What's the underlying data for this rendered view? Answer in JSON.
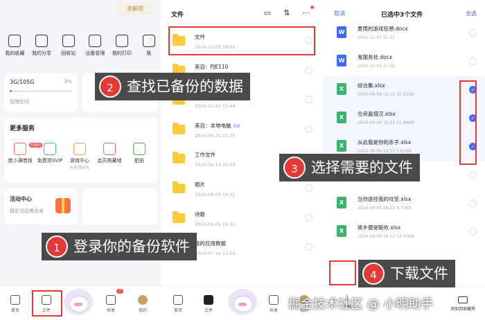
{
  "p1": {
    "top_pill": "去解锁",
    "quick": [
      {
        "icon": "star-icon",
        "label": "我的收藏"
      },
      {
        "icon": "share-icon",
        "label": "我的分享"
      },
      {
        "icon": "recycle-icon",
        "label": "回收站"
      },
      {
        "icon": "device-icon",
        "label": "设备管理"
      },
      {
        "icon": "printer-icon",
        "label": "我的打印"
      },
      {
        "icon": "more-icon",
        "label": "我"
      }
    ],
    "storage": {
      "text": "3G/105G",
      "percent": "3%",
      "progress": 0.03,
      "manage": "管理空间"
    },
    "services": {
      "title": "更多服务",
      "items": [
        {
          "label": "度小满借钱",
          "sub": "",
          "color": "#ff6b6b",
          "badge": "有福利"
        },
        {
          "label": "免费领SVIP",
          "sub": "",
          "color": "#3cc77b",
          "badge": ""
        },
        {
          "label": "游戏中心",
          "sub": "天天领好礼",
          "color": "#ff9f43",
          "badge": ""
        },
        {
          "label": "会员购藏域",
          "sub": "",
          "color": "#ff5c7a",
          "badge": ""
        },
        {
          "label": "航拍",
          "sub": "",
          "color": "#4caf50",
          "badge": ""
        }
      ]
    },
    "activity": {
      "title": "活动中心",
      "desc": "精彩活动等你来"
    },
    "tabs": [
      {
        "label": "首页"
      },
      {
        "label": "文件"
      },
      {
        "label": "共享"
      },
      {
        "label": "我的"
      }
    ],
    "share_badge": "7"
  },
  "p2": {
    "title": "文件",
    "files": [
      {
        "name": "文件",
        "date": "2024-12-03  18:00",
        "src": ""
      },
      {
        "name": "来自：PJE110",
        "date": "2024-11-15  15:44",
        "src": ""
      },
      {
        "name": "来自：微信备份",
        "date": "2024-11-15  15:44",
        "src": ""
      },
      {
        "name": "来自：本地电脑",
        "date": "2024-09-20  15:35",
        "src": "同步"
      },
      {
        "name": "工作文件",
        "date": "2024-09-14  15:03",
        "src": ""
      },
      {
        "name": "照片",
        "date": "2024-08-09  16:31",
        "src": ""
      },
      {
        "name": "诗歌",
        "date": "2024-08-09  16:31",
        "src": ""
      },
      {
        "name": "我的应用数据",
        "date": "2024-07-16  13:52",
        "src": ""
      }
    ],
    "tabs": [
      {
        "label": "首页"
      },
      {
        "label": "文件"
      },
      {
        "label": "共享"
      },
      {
        "label": "我的"
      }
    ]
  },
  "p3": {
    "cancel": "取消",
    "title": "已选中3个文件",
    "select_all": "全选",
    "docs": [
      {
        "name": "夏雨的游戏狂想.docx",
        "date": "2024-12-03  21:32",
        "type": "W",
        "color": "#3e6bff",
        "selected": false
      },
      {
        "name": "鬼服务处.docx",
        "date": "2024-12-03  21:32",
        "type": "W",
        "color": "#3e6bff",
        "selected": false
      },
      {
        "name": "综合集.xlsx",
        "date": "2024-08-09  16:12  30.61KB",
        "type": "X",
        "color": "#3cb371",
        "selected": true
      },
      {
        "name": "仓央嘉措汉.xlsx",
        "date": "2024-08-09  16:12  11.86KB",
        "type": "X",
        "color": "#3cb371",
        "selected": true
      },
      {
        "name": "从此我是你的赤子.xlsx",
        "date": "2024-08-09  16:12  5.62KB",
        "type": "X",
        "color": "#3cb371",
        "selected": true
      },
      {
        "name": "",
        "date": "",
        "type": "X",
        "color": "#3cb371",
        "selected": false
      },
      {
        "name": "当你途径我的坟茔.xlsx",
        "date": "2024-08-09  16:12  9.72KB",
        "type": "X",
        "color": "#3cb371",
        "selected": false
      },
      {
        "name": "故乡便是贩依.xlsx",
        "date": "2024-08-09  16:12  53.45KB",
        "type": "X",
        "color": "#3cb371",
        "selected": false
      }
    ],
    "download": "下载",
    "more": "添加到收藏夹"
  },
  "callouts": {
    "c1": {
      "num": "1",
      "text": "登录你的备份软件"
    },
    "c2": {
      "num": "2",
      "text": "查找已备份的数据"
    },
    "c3": {
      "num": "3",
      "text": "选择需要的文件"
    },
    "c4": {
      "num": "4",
      "text": "下载文件"
    }
  },
  "watermark": "掘金技术社区 @ 小明助手"
}
